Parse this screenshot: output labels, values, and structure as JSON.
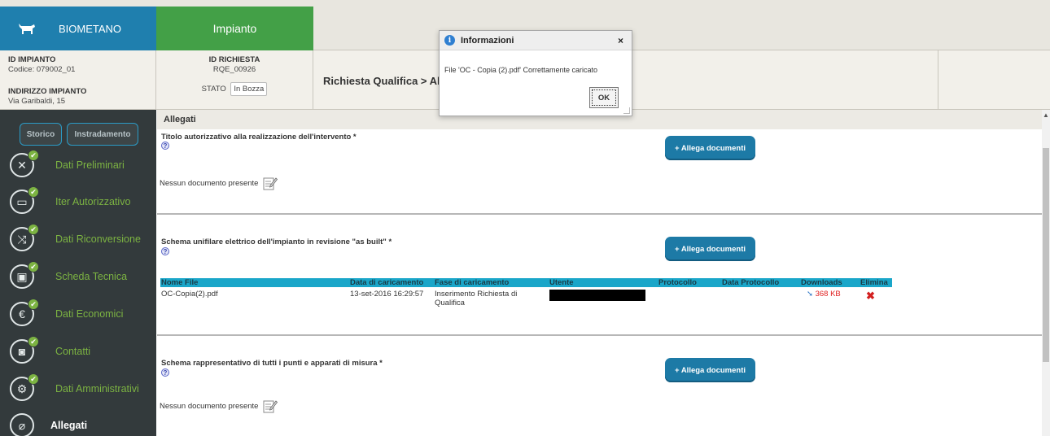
{
  "header": {
    "brand": "BIOMETANO",
    "tab_impianto": "Impianto"
  },
  "info": {
    "id_impianto_label": "ID IMPIANTO",
    "codice": "Codice: 079002_01",
    "indirizzo_label": "INDIRIZZO IMPIANTO",
    "indirizzo": "Via Garibaldi, 15",
    "id_richiesta_label": "ID RICHIESTA",
    "id_richiesta": "RQE_00926",
    "stato_label": "STATO",
    "stato_value": "In Bozza",
    "breadcrumb": "Richiesta Qualifica > Al"
  },
  "sidebar": {
    "btn_storico": "Storico",
    "btn_instradamento": "Instradamento",
    "items": [
      {
        "label": "Dati Preliminari",
        "icon": "tools-icon",
        "glyph": "✕"
      },
      {
        "label": "Iter Autorizzativo",
        "icon": "calendar-icon",
        "glyph": "▭"
      },
      {
        "label": "Dati Riconversione",
        "icon": "shuffle-icon",
        "glyph": "⤨"
      },
      {
        "label": "Scheda Tecnica",
        "icon": "wallet-icon",
        "glyph": "▣"
      },
      {
        "label": "Dati Economici",
        "icon": "euro-icon",
        "glyph": "€"
      },
      {
        "label": "Contatti",
        "icon": "contacts-icon",
        "glyph": "◙"
      },
      {
        "label": "Dati Amministrativi",
        "icon": "settings-icon",
        "glyph": "⚙"
      },
      {
        "label": "Allegati",
        "icon": "paperclip-icon",
        "glyph": "⌀"
      }
    ]
  },
  "main": {
    "section_title": "Allegati",
    "allega_label": "+ Allega documenti",
    "nessun_documento": "Nessun documento presente",
    "help": "?",
    "sections": [
      {
        "title": "Titolo autorizzativo alla realizzazione dell'intervento *"
      },
      {
        "title": "Schema unifilare elettrico dell'impianto in revisione \"as built\" *"
      },
      {
        "title": "Schema rappresentativo di tutti i punti e apparati di misura *"
      }
    ],
    "table": {
      "headers": [
        "Nome File",
        "Data di caricamento",
        "Fase di caricamento",
        "Utente",
        "Protocollo",
        "Data Protocollo",
        "Downloads",
        "Elimina"
      ],
      "row": {
        "nome_file": "OC-Copia(2).pdf",
        "data": "13-set-2016 16:29:57",
        "fase": "Inserimento Richiesta di Qualifica",
        "download_size": "368 KB",
        "elimina": "✖"
      }
    }
  },
  "dialog": {
    "title": "Informazioni",
    "close": "×",
    "message": "File 'OC - Copia (2).pdf' Correttamente caricato",
    "ok": "OK"
  }
}
